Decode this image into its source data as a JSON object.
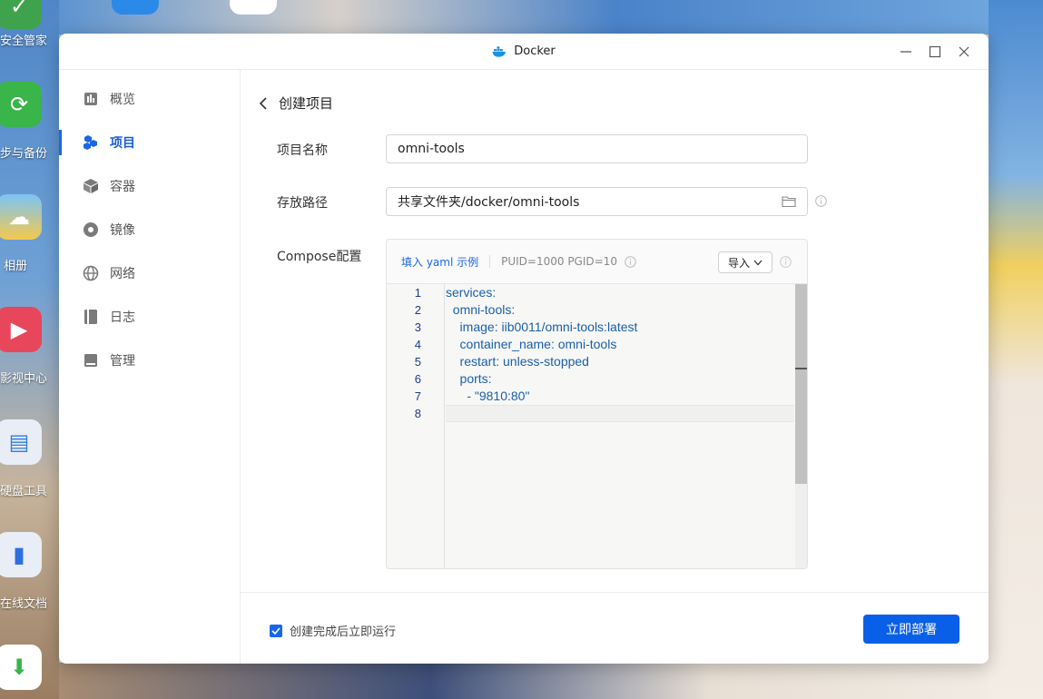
{
  "desktop": {
    "icons": [
      {
        "label": "安全管家",
        "icon": "shield-icon",
        "color": "#3fa34d"
      },
      {
        "label": "步与备份",
        "icon": "sync-icon",
        "color": "#39b54a"
      },
      {
        "label": "相册",
        "icon": "photo-icon",
        "color": "#3a9ee8"
      },
      {
        "label": "影视中心",
        "icon": "video-icon",
        "color": "#e8465b"
      },
      {
        "label": "硬盘工具",
        "icon": "disk-icon",
        "color": "#2f7ce0"
      },
      {
        "label": "在线文档",
        "icon": "document-icon",
        "color": "#2f6fe0"
      },
      {
        "label": "",
        "icon": "download-icon",
        "color": "#39b54a"
      }
    ]
  },
  "window": {
    "title": "Docker",
    "controls": [
      "minimize",
      "maximize",
      "close"
    ]
  },
  "sidebar": {
    "items": [
      {
        "label": "概览",
        "icon": "overview-icon",
        "active": false
      },
      {
        "label": "项目",
        "icon": "project-icon",
        "active": true
      },
      {
        "label": "容器",
        "icon": "container-icon",
        "active": false
      },
      {
        "label": "镜像",
        "icon": "image-icon",
        "active": false
      },
      {
        "label": "网络",
        "icon": "network-icon",
        "active": false
      },
      {
        "label": "日志",
        "icon": "log-icon",
        "active": false
      },
      {
        "label": "管理",
        "icon": "manage-icon",
        "active": false
      }
    ]
  },
  "main": {
    "heading": "创建项目",
    "name_label": "项目名称",
    "name_value": "omni-tools",
    "path_label": "存放路径",
    "path_value": "共享文件夹/docker/omni-tools",
    "compose_label": "Compose配置",
    "fill_example": "填入 yaml 示例",
    "puid_text": "PUID=1000 PGID=10",
    "import_label": "导入",
    "code_lines": [
      "services:",
      "  omni-tools:",
      "    image: iib0011/omni-tools:latest",
      "    container_name: omni-tools",
      "    restart: unless-stopped",
      "    ports:",
      "      - \"9810:80\"",
      ""
    ]
  },
  "footer": {
    "checkbox_label": "创建完成后立即运行",
    "checkbox_checked": true,
    "deploy_label": "立即部署"
  },
  "colors": {
    "accent": "#1a66e8",
    "code_text": "#1a5fa8"
  }
}
